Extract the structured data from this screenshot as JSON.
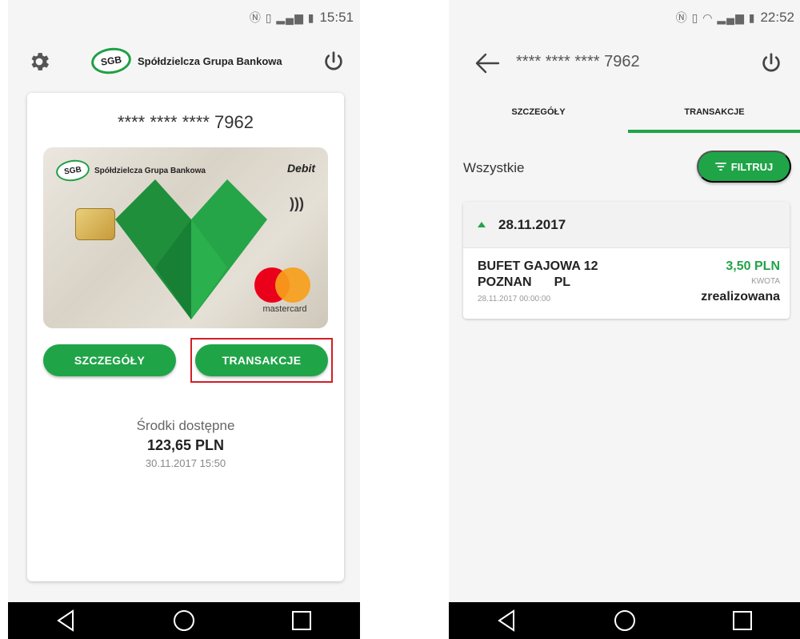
{
  "left": {
    "status_time": "15:51",
    "bank_name": "Spółdzielcza Grupa Bankowa",
    "logo_text": "SGB",
    "card_number_masked": "**** **** **** 7962",
    "card": {
      "logo_text": "SGB",
      "brand_name": "Spółdzielcza Grupa Bankowa",
      "type_label": "Debit",
      "network_label": "mastercard"
    },
    "buttons": {
      "details": "SZCZEGÓŁY",
      "transactions": "TRANSAKCJE"
    },
    "funds": {
      "label": "Środki dostępne",
      "amount": "123,65 PLN",
      "date": "30.11.2017 15:50"
    }
  },
  "right": {
    "status_time": "22:52",
    "card_number_masked": "**** **** **** 7962",
    "tabs": [
      {
        "label": "SZCZEGÓŁY",
        "active": false
      },
      {
        "label": "TRANSAKCJE",
        "active": true
      }
    ],
    "filter": {
      "label": "Wszystkie",
      "button": "FILTRUJ"
    },
    "group": {
      "date": "28.11.2017",
      "transactions": [
        {
          "merchant": "BUFET GAJOWA 12",
          "city": "POZNAN",
          "country": "PL",
          "datetime": "28.11.2017 00:00:00",
          "amount": "3,50 PLN",
          "amount_label": "KWOTA",
          "status": "zrealizowana"
        }
      ]
    }
  },
  "colors": {
    "accent_green": "#20a448",
    "highlight_red": "#d21f26"
  },
  "icons": [
    "gear-icon",
    "power-icon",
    "back-arrow-icon",
    "filter-icon",
    "nav-back-icon",
    "nav-home-icon",
    "nav-recents-icon",
    "nfc-icon",
    "vibrate-icon",
    "wifi-icon",
    "signal-icon",
    "battery-icon",
    "contactless-icon"
  ]
}
